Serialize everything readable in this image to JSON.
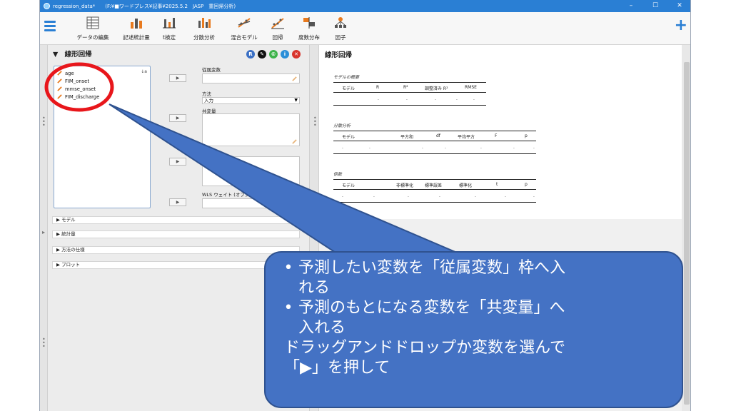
{
  "window": {
    "title": "regression_data*",
    "path": "(F:¥■ワードプレス¥記事¥2025.5.2　JASP　重回帰分析)",
    "controls": [
      "–",
      "☐",
      "✕"
    ]
  },
  "ribbon": {
    "buttons": [
      {
        "label": "データの編集",
        "icon": "table-icon"
      },
      {
        "label": "記述統計量",
        "icon": "bar-chart-icon"
      },
      {
        "label": "t検定",
        "icon": "ttest-icon"
      },
      {
        "label": "分散分析",
        "icon": "anova-icon"
      },
      {
        "label": "混合モデル",
        "icon": "mixed-model-icon"
      },
      {
        "label": "回帰",
        "icon": "regression-icon"
      },
      {
        "label": "度数分布",
        "icon": "frequency-icon"
      },
      {
        "label": "因子",
        "icon": "factor-icon"
      }
    ],
    "plus": "+"
  },
  "analysis": {
    "title": "線形回帰",
    "icons": [
      "R",
      "✎",
      "©",
      "i",
      "✕"
    ],
    "variables": [
      "age",
      "FIM_onset",
      "mmse_onset",
      "FIM_discharge"
    ],
    "sort_icon": "↓a",
    "arrow": "▶",
    "fields": {
      "dependent": "従属変数",
      "method": "方法",
      "method_value": "入力",
      "covariates": "共変量",
      "wls": "WLS ウェイト (オプショ"
    },
    "sections": [
      "モデル",
      "統計量",
      "方法の仕様",
      "プロット"
    ]
  },
  "results": {
    "title": "線形回帰",
    "model_summary": {
      "label": "モデルの概要",
      "headers": [
        "モデル",
        "R",
        "R²",
        "調整済み R²",
        "RMSE"
      ],
      "row": [
        ".",
        ".",
        ".",
        ".",
        "."
      ]
    },
    "anova": {
      "label": "分散分析",
      "headers": [
        "モデル",
        "平方和",
        "df",
        "平均平方",
        "F",
        "p"
      ],
      "row": [
        ".",
        ".",
        ".",
        ".",
        ".",
        ".",
        "."
      ]
    },
    "coefficients": {
      "label": "係数",
      "headers": [
        "モデル",
        "非標準化",
        "標準誤差",
        "標準化",
        "t",
        "p"
      ],
      "row": [
        ".",
        ".",
        ".",
        ".",
        ".",
        ".",
        "."
      ]
    }
  },
  "callout": {
    "bullet": "•",
    "b1": "予測したい変数を「従属変数」枠へ入",
    "b1b": "れる",
    "b2": "予測のもとになる変数を「共変量」へ",
    "b2b": "入れる",
    "p1": "ドラッグアンドドロップか変数を選んで",
    "p2": "「▶」を押して"
  }
}
